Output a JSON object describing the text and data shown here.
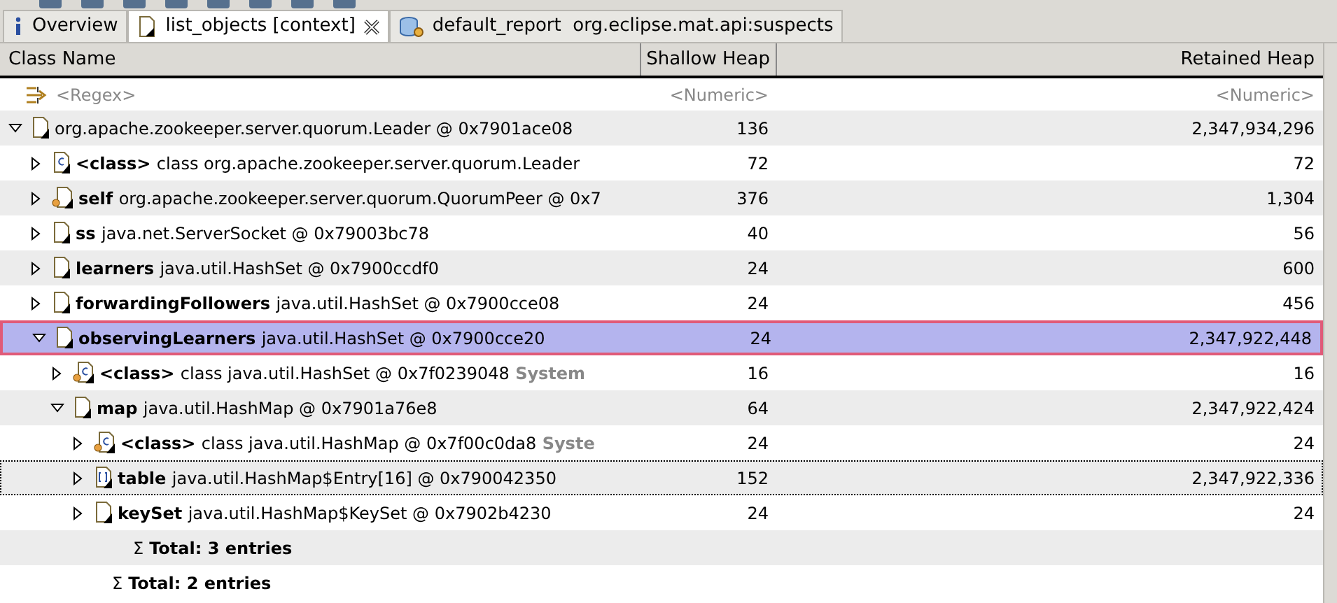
{
  "tabs": [
    {
      "label": "Overview",
      "selected": false
    },
    {
      "label": "list_objects [context]",
      "selected": true,
      "closable": true
    },
    {
      "label": "default_report  org.eclipse.mat.api:suspects",
      "selected": false
    }
  ],
  "table": {
    "columns": [
      "Class Name",
      "Shallow Heap",
      "Retained Heap"
    ],
    "filter": {
      "name_placeholder": "<Regex>",
      "shallow_placeholder": "<Numeric>",
      "retained_placeholder": "<Numeric>"
    },
    "rows": [
      {
        "kind": "object",
        "expanded": true,
        "name": "",
        "text": "org.apache.zookeeper.server.quorum.Leader @ 0x7901ace08",
        "shallow": "136",
        "retained": "2,347,934,296",
        "selected": false,
        "focused": false,
        "children": [
          {
            "kind": "class",
            "expanded": false,
            "name": "<class>",
            "text": "class org.apache.zookeeper.server.quorum.Leader",
            "shallow": "72",
            "retained": "72",
            "selected": false,
            "focused": false
          },
          {
            "kind": "static-object",
            "expanded": false,
            "name": "self",
            "text": "org.apache.zookeeper.server.quorum.QuorumPeer @ 0x7",
            "shallow": "376",
            "retained": "1,304",
            "selected": false,
            "focused": false
          },
          {
            "kind": "object",
            "expanded": false,
            "name": "ss",
            "text": "java.net.ServerSocket @ 0x79003bc78",
            "shallow": "40",
            "retained": "56",
            "selected": false,
            "focused": false
          },
          {
            "kind": "object",
            "expanded": false,
            "name": "learners",
            "text": "java.util.HashSet @ 0x7900ccdf0",
            "shallow": "24",
            "retained": "600",
            "selected": false,
            "focused": false
          },
          {
            "kind": "object",
            "expanded": false,
            "name": "forwardingFollowers",
            "text": "java.util.HashSet @ 0x7900cce08",
            "shallow": "24",
            "retained": "456",
            "selected": false,
            "focused": false
          },
          {
            "kind": "object",
            "expanded": true,
            "name": "observingLearners",
            "text": "java.util.HashSet @ 0x7900cce20",
            "shallow": "24",
            "retained": "2,347,922,448",
            "selected": true,
            "focused": false,
            "children": [
              {
                "kind": "static-class",
                "expanded": false,
                "name": "<class>",
                "text": "class java.util.HashSet @ 0x7f0239048",
                "suffix": "System",
                "shallow": "16",
                "retained": "16",
                "selected": false,
                "focused": false
              },
              {
                "kind": "object",
                "expanded": true,
                "name": "map",
                "text": "java.util.HashMap @ 0x7901a76e8",
                "shallow": "64",
                "retained": "2,347,922,424",
                "selected": false,
                "focused": false,
                "children": [
                  {
                    "kind": "static-class",
                    "expanded": false,
                    "name": "<class>",
                    "text": "class java.util.HashMap @ 0x7f00c0da8",
                    "suffix": "Syste",
                    "shallow": "24",
                    "retained": "24",
                    "selected": false,
                    "focused": false
                  },
                  {
                    "kind": "array",
                    "expanded": false,
                    "name": "table",
                    "text": "java.util.HashMap$Entry[16] @ 0x790042350",
                    "shallow": "152",
                    "retained": "2,347,922,336",
                    "selected": false,
                    "focused": true
                  },
                  {
                    "kind": "object",
                    "expanded": false,
                    "name": "keySet",
                    "text": "java.util.HashMap$KeySet @ 0x7902b4230",
                    "shallow": "24",
                    "retained": "24",
                    "selected": false,
                    "focused": false
                  },
                  {
                    "kind": "total",
                    "symbol": "Σ",
                    "text": "Total: 3 entries"
                  }
                ]
              },
              {
                "kind": "total",
                "symbol": "Σ",
                "text": "Total: 2 entries"
              }
            ]
          }
        ]
      }
    ]
  }
}
